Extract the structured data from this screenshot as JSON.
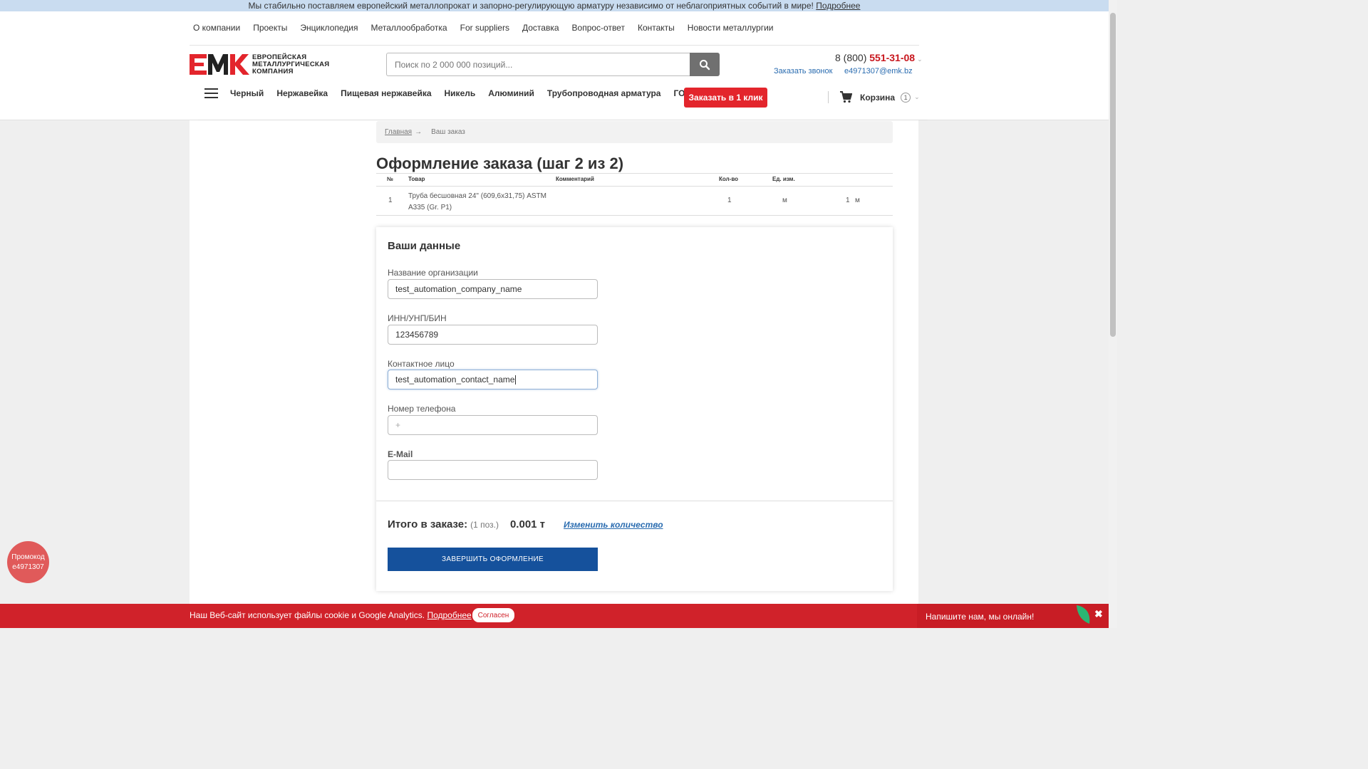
{
  "banner": {
    "text": "Мы стабильно поставляем европейский металлопрокат и запорно-регулирующую арматуру независимо от неблагоприятных событий в мире!",
    "link": "Подробнее"
  },
  "topnav": [
    "О компании",
    "Проекты",
    "Энциклопедия",
    "Металлообработка",
    "For suppliers",
    "Доставка",
    "Вопрос-ответ",
    "Контакты",
    "Новости металлургии"
  ],
  "logo": {
    "line1": "ЕВРОПЕЙСКАЯ",
    "line2": "МЕТАЛЛУРГИЧЕСКАЯ",
    "line3": "КОМПАНИЯ"
  },
  "search": {
    "placeholder": "Поиск по 2 000 000 позиций..."
  },
  "contacts": {
    "phone_prefix": "8 (800)",
    "phone_number": "551-31-08",
    "callback": "Заказать звонок",
    "email": "e4971307@emk.bz"
  },
  "catnav": [
    "Черный",
    "Нержавейка",
    "Пищевая нержавейка",
    "Никель",
    "Алюминий",
    "Трубопроводная арматура",
    "ГОСТ"
  ],
  "oneclick_label": "Заказать в 1 клик",
  "cart": {
    "label": "Корзина",
    "count": "1"
  },
  "breadcrumb": {
    "home": "Главная",
    "arrow": "→",
    "current": "Ваш заказ"
  },
  "page_title": "Оформление заказа (шаг 2 из 2)",
  "order_table": {
    "headers": {
      "num": "№",
      "product": "Товар",
      "comment": "Комментарий",
      "qty": "Кол-во",
      "unit": "Ед. изм."
    },
    "rows": [
      {
        "num": "1",
        "product_line1": "Труба бесшовная 24\" (609,6x31,75) ASTM",
        "product_line2": "A335 (Gr. P1)",
        "qty": "1",
        "unit": "м",
        "total_qty": "1",
        "total_unit": "м"
      }
    ]
  },
  "form": {
    "title": "Ваши данные",
    "org_label": "Название организации",
    "org_value": "test_automation_company_name",
    "inn_label": "ИНН/УНП/БИН",
    "inn_value": "123456789",
    "contact_label": "Контактное лицо",
    "contact_value": "test_automation_contact_name",
    "phone_label": "Номер телефона",
    "phone_placeholder": "+",
    "email_label": "E-Mail",
    "email_value": ""
  },
  "total": {
    "label": "Итого в заказе:",
    "positions": "(1 поз.)",
    "weight": "0.001 т",
    "change_qty": "Изменить количество"
  },
  "finish_button": "ЗАВЕРШИТЬ ОФОРМЛЕНИЕ",
  "promo": {
    "line1": "Промокод",
    "line2": "e4971307"
  },
  "cookie": {
    "text": "Наш Веб-сайт использует файлы cookie и Google Analytics.",
    "link": "Подробнее",
    "agree": "Согласен"
  },
  "chat": {
    "text": "Напишите нам, мы онлайн!",
    "close": "✖"
  },
  "colors": {
    "brand_red": "#e3252c",
    "primary_blue": "#15519c",
    "link_blue": "#2a6cb0"
  }
}
